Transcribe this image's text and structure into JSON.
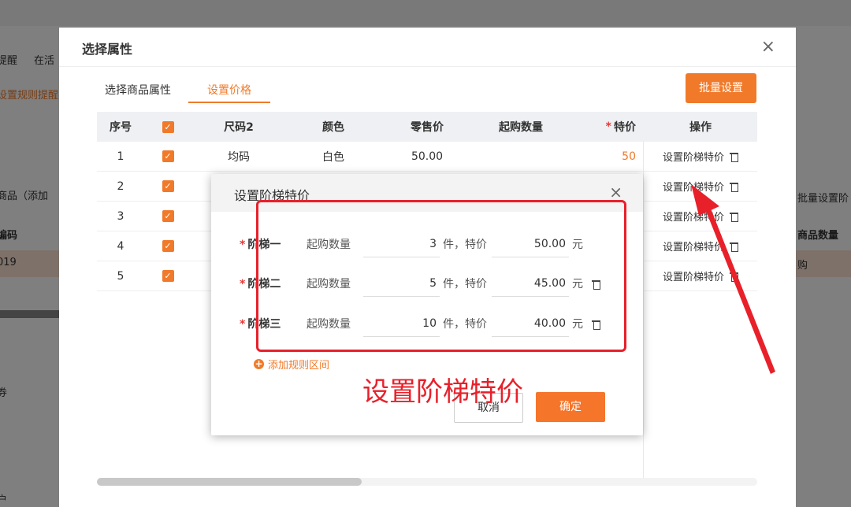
{
  "background": {
    "left_texts": [
      "提醒",
      "在活",
      "设置规则提醒",
      "商品（添加",
      "编码",
      "019",
      "券",
      "户"
    ],
    "right_texts": [
      "批量设置阶",
      "商品数量",
      "购"
    ]
  },
  "dialog": {
    "title": "选择属性",
    "close": "×",
    "tabs": [
      {
        "label": "选择商品属性"
      },
      {
        "label": "设置价格"
      }
    ],
    "batch_button": "批量设置",
    "table": {
      "headers": {
        "seq": "序号",
        "size": "尺码2",
        "color": "颜色",
        "retail": "零售价",
        "min_qty": "起购数量",
        "special_req": "*",
        "special": "特价",
        "op": "操作"
      },
      "rows": [
        {
          "seq": "1",
          "size": "均码",
          "color": "白色",
          "retail": "50.00",
          "special": "50",
          "op": "设置阶梯特价"
        },
        {
          "seq": "2",
          "size": "",
          "color": "",
          "retail": "",
          "special": "",
          "op": "设置阶梯特价"
        },
        {
          "seq": "3",
          "size": "",
          "color": "",
          "retail": "",
          "special": "",
          "op": "设置阶梯特价"
        },
        {
          "seq": "4",
          "size": "",
          "color": "",
          "retail": "",
          "special": "",
          "op": "设置阶梯特价"
        },
        {
          "seq": "5",
          "size": "",
          "color": "",
          "retail": "",
          "special": "",
          "op": "设置阶梯特价"
        }
      ]
    }
  },
  "tier_dialog": {
    "title": "设置阶梯特价",
    "close": "×",
    "tiers": [
      {
        "req": "*",
        "label": "阶梯一",
        "qty_label": "起购数量",
        "qty": "3",
        "unit": "件，特价",
        "price": "50.00",
        "currency": "元"
      },
      {
        "req": "*",
        "label": "阶梯二",
        "qty_label": "起购数量",
        "qty": "5",
        "unit": "件，特价",
        "price": "45.00",
        "currency": "元"
      },
      {
        "req": "*",
        "label": "阶梯三",
        "qty_label": "起购数量",
        "qty": "10",
        "unit": "件，特价",
        "price": "40.00",
        "currency": "元"
      }
    ],
    "add_rule": "添加规则区间",
    "cancel": "取消",
    "confirm": "确定"
  },
  "annotation": {
    "text": "设置阶梯特价",
    "color": "#e8202a"
  },
  "colors": {
    "accent": "#f07a2a",
    "required": "#e53935"
  }
}
